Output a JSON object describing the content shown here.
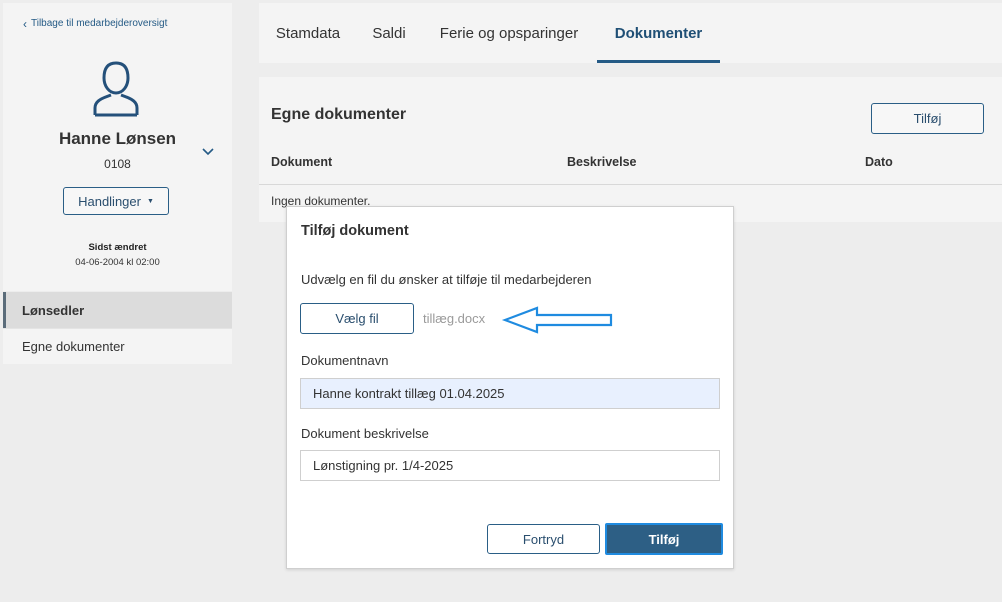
{
  "sidebar": {
    "back_link": "Tilbage til medarbejderoversigt",
    "employee_name": "Hanne Lønsen",
    "employee_id": "0108",
    "actions_label": "Handlinger",
    "last_changed_label": "Sidst ændret",
    "last_changed_value": "04-06-2004 kl 02:00",
    "nav_items": [
      {
        "label": "Lønsedler",
        "active": true
      },
      {
        "label": "Egne dokumenter",
        "active": false
      }
    ]
  },
  "tabs": [
    {
      "label": "Stamdata",
      "active": false
    },
    {
      "label": "Saldi",
      "active": false
    },
    {
      "label": "Ferie og opsparinger",
      "active": false
    },
    {
      "label": "Dokumenter",
      "active": true
    }
  ],
  "documents": {
    "title": "Egne dokumenter",
    "add_label": "Tilføj",
    "columns": [
      "Dokument",
      "Beskrivelse",
      "Dato"
    ],
    "empty_text": "Ingen dokumenter."
  },
  "modal": {
    "title": "Tilføj dokument",
    "instruction": "Udvælg en fil du ønsker at tilføje til medarbejderen",
    "choose_file_label": "Vælg fil",
    "file_name": "tillæg.docx",
    "name_label": "Dokumentnavn",
    "name_value": "Hanne kontrakt tillæg 01.04.2025",
    "description_label": "Dokument beskrivelse",
    "description_value": "Lønstigning pr. 1/4-2025",
    "cancel_label": "Fortryd",
    "submit_label": "Tilføj"
  },
  "colors": {
    "primary": "#2d5f85",
    "link": "#245a85",
    "arrow": "#1f8be0",
    "autofill": "#e8f0fe"
  },
  "icons": {
    "back": "chevron-left-icon",
    "avatar": "user-icon",
    "expand": "chevron-down-icon",
    "actions_caret": "caret-down-icon",
    "annotation": "arrow-left-icon"
  }
}
